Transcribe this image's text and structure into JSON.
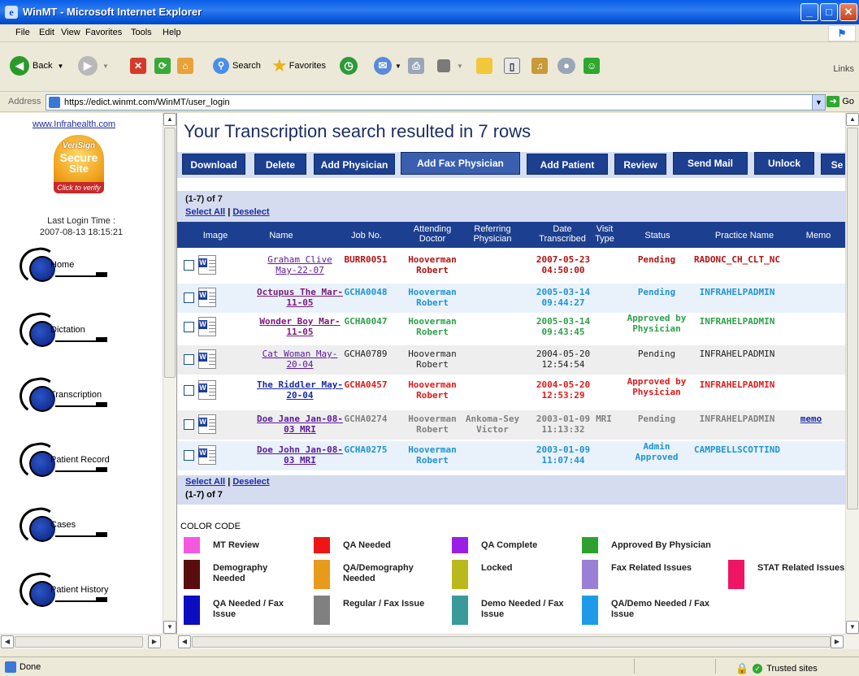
{
  "window": {
    "title": "WinMT - Microsoft Internet Explorer",
    "icon": "ie-icon"
  },
  "menu": [
    "File",
    "Edit",
    "View",
    "Favorites",
    "Tools",
    "Help"
  ],
  "toolbar": {
    "back": "Back",
    "search": "Search",
    "favorites": "Favorites",
    "links": "Links"
  },
  "address": {
    "label": "Address",
    "url": "https://edict.winmt.com/WinMT/user_login",
    "go": "Go"
  },
  "sidebar": {
    "site_link": "www.Infrahealth.com",
    "seal": {
      "line1": "VeriSign",
      "line2": "Secure",
      "line3": "Site",
      "line4": "Click to verify"
    },
    "last_login_label": "Last Login Time :",
    "last_login_value": "2007-08-13 18:15:21",
    "items": [
      "Home",
      "Dictation",
      "Transcription",
      "Patient Record",
      "Cases",
      "Patient History"
    ]
  },
  "main": {
    "heading": "Your Transcription search resulted in 7 rows",
    "actions": [
      "Download",
      "Delete",
      "Add Physician",
      "Add Fax Physician",
      "Add Patient",
      "Review",
      "Send Mail",
      "Unlock",
      "Se"
    ],
    "range": "(1-7) of 7",
    "select_all": "Select All",
    "separator": "|",
    "deselect": "Deselect",
    "columns": [
      "Image",
      "Name",
      "Job No.",
      "Attending\nDoctor",
      "Referring\nPhysician",
      "Date\nTranscribed",
      "Visit\nType",
      "Status",
      "Practice Name",
      "Memo"
    ],
    "rows": [
      {
        "name": "Graham Clive May-22-07",
        "job": "BURR0051",
        "doctor": "Hooverman Robert",
        "referring": "",
        "date": "2007-05-23 04:50:00",
        "visit": "",
        "status": "Pending",
        "practice": "RADONC_CH_CLT_NC",
        "memo": "",
        "color": "#b01313",
        "name_color": "#5a1a9a"
      },
      {
        "name": "Octupus The Mar-11-05",
        "job": "GCHA0048",
        "doctor": "Hooverman Robert",
        "referring": "",
        "date": "2005-03-14 09:44:27",
        "visit": "",
        "status": "Pending",
        "practice": "INFRAHELPADMIN",
        "memo": "",
        "color": "#1e93d3",
        "name_color": "#7a1a7a"
      },
      {
        "name": "Wonder Boy Mar-11-05",
        "job": "GCHA0047",
        "doctor": "Hooverman Robert",
        "referring": "",
        "date": "2005-03-14 09:43:45",
        "visit": "",
        "status": "Approved by Physician",
        "practice": "INFRAHELPADMIN",
        "memo": "",
        "color": "#2ca048",
        "name_color": "#7a1a7a"
      },
      {
        "name": "Cat Woman May-20-04",
        "job": "GCHA0789",
        "doctor": "Hooverman Robert",
        "referring": "",
        "date": "2004-05-20 12:54:54",
        "visit": "",
        "status": "Pending",
        "practice": "INFRAHELPADMIN",
        "memo": "",
        "color": "#222222",
        "name_color": "#5a1a9a"
      },
      {
        "name": "The Riddler May-20-04",
        "job": "GCHA0457",
        "doctor": "Hooverman Robert",
        "referring": "",
        "date": "2004-05-20 12:53:29",
        "visit": "",
        "status": "Approved by Physician",
        "practice": "INFRAHELPADMIN",
        "memo": "",
        "color": "#e01a1a",
        "name_color": "#1b2ba4"
      },
      {
        "name": "Doe Jane Jan-08-03 MRI",
        "job": "GCHA0274",
        "doctor": "Hooverman Robert",
        "referring": "Ankoma-Sey Victor",
        "date": "2003-01-09 11:13:32",
        "visit": "MRI",
        "status": "Pending",
        "practice": "INFRAHELPADMIN",
        "memo": "memo",
        "color": "#808080",
        "name_color": "#5a1a9a"
      },
      {
        "name": "Doe John Jan-08-03 MRI",
        "job": "GCHA0275",
        "doctor": "Hooverman Robert",
        "referring": "",
        "date": "2003-01-09 11:07:44",
        "visit": "",
        "status": "Admin Approved",
        "practice": "CAMPBELLSCOTTIND",
        "memo": "",
        "color": "#1e93d3",
        "name_color": "#5a1a9a"
      }
    ],
    "color_code": {
      "title": "COLOR CODE",
      "items": [
        {
          "label": "MT Review",
          "color": "#f558e0"
        },
        {
          "label": "QA Needed",
          "color": "#f01414"
        },
        {
          "label": "QA Complete",
          "color": "#9b1ee6"
        },
        {
          "label": "Approved By Physician",
          "color": "#2fa030"
        },
        {
          "label": "Demography Needed",
          "color": "#5a0d0d"
        },
        {
          "label": "QA/Demography Needed",
          "color": "#e89a1c"
        },
        {
          "label": "Locked",
          "color": "#b9b91c"
        },
        {
          "label": "Fax Related Issues",
          "color": "#9a7fd6"
        },
        {
          "label": "STAT Related Issues",
          "color": "#f01465"
        },
        {
          "label": "QA Needed / Fax Issue",
          "color": "#0c0cc0"
        },
        {
          "label": "Regular / Fax Issue",
          "color": "#808080"
        },
        {
          "label": "Demo Needed / Fax Issue",
          "color": "#3a9a9a"
        },
        {
          "label": "QA/Demo Needed / Fax Issue",
          "color": "#1e9be8"
        }
      ]
    }
  },
  "status": {
    "text": "Done",
    "zone": "Trusted sites"
  }
}
